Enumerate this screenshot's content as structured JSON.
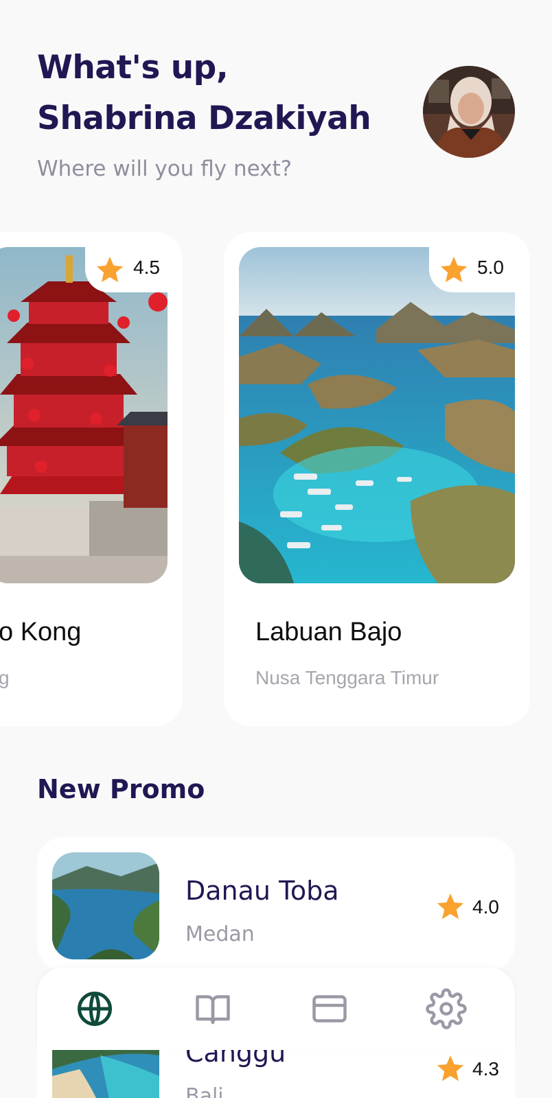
{
  "header": {
    "greeting_line1": "What's up,",
    "greeting_line2": "Shabrina Dzakiyah",
    "subtitle": "Where will you fly next?",
    "avatar_icon": "user-avatar"
  },
  "destinations": [
    {
      "name": "Hong Kong",
      "visible_name": "o Kong",
      "location": "Hong Kong",
      "visible_location": "g",
      "rating": "4.5"
    },
    {
      "name": "Labuan Bajo",
      "location": "Nusa Tenggara Timur",
      "rating": "5.0"
    }
  ],
  "promo": {
    "section_title": "New Promo",
    "items": [
      {
        "name": "Danau Toba",
        "location": "Medan",
        "rating": "4.0"
      },
      {
        "name": "Canggu",
        "location": "Bali",
        "rating": "4.3"
      }
    ]
  },
  "nav": {
    "items": [
      {
        "icon": "globe-icon",
        "active": true
      },
      {
        "icon": "book-icon",
        "active": false
      },
      {
        "icon": "card-icon",
        "active": false
      },
      {
        "icon": "gear-icon",
        "active": false
      }
    ]
  },
  "colors": {
    "heading": "#1f1853",
    "muted": "#8e8e9e",
    "star": "#f9a230",
    "nav_active": "#0f4a3c",
    "nav_inactive": "#9a9aa6"
  }
}
